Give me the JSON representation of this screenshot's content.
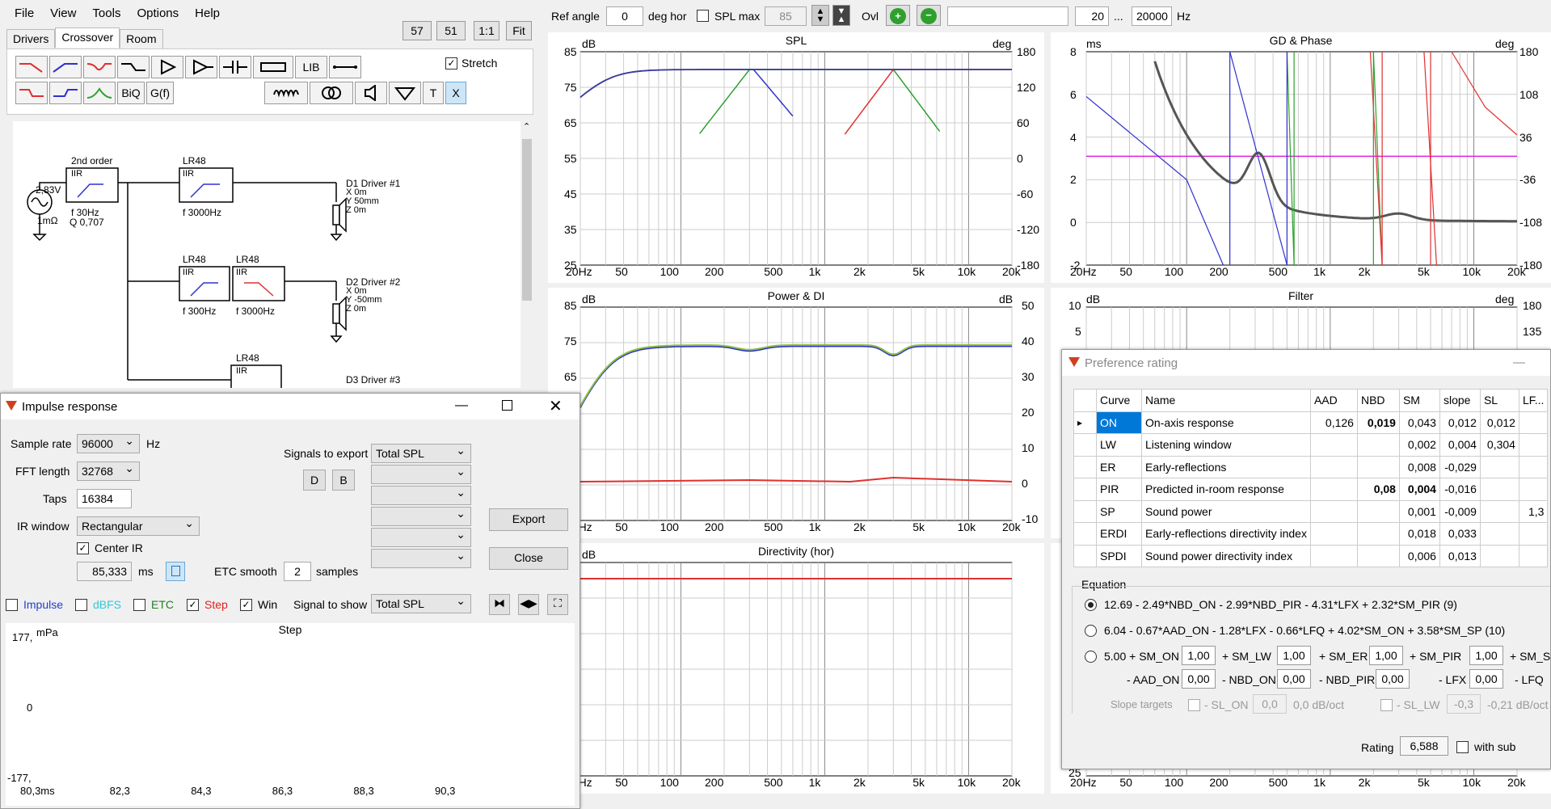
{
  "menu": [
    "File",
    "View",
    "Tools",
    "Options",
    "Help"
  ],
  "tabs": [
    "Drivers",
    "Crossover",
    "Room"
  ],
  "view_buttons": [
    "57",
    "51",
    "1:1",
    "Fit"
  ],
  "top_controls": {
    "ref_angle_label": "Ref angle",
    "ref_angle_value": "0",
    "deg_hor": "deg hor",
    "spl_max_label": "SPL max",
    "spl_max_value": "85",
    "ovl_label": "Ovl",
    "freq_min": "20",
    "dots": "...",
    "freq_max": "20000",
    "hz": "Hz"
  },
  "toolbar": {
    "lib": "LIB",
    "biq": "BiQ",
    "gf": "G(f)",
    "t": "T",
    "x": "X",
    "stretch_label": "Stretch"
  },
  "schematic": {
    "source_v": "2,83V",
    "source_r": "1mΩ",
    "block1_title": "2nd order",
    "block1_type": "IIR",
    "block1_f": "f  30Hz",
    "block1_q": "Q 0,707",
    "lr48": "LR48",
    "iir": "IIR",
    "f3000": "f  3000Hz",
    "f300": "f  300Hz",
    "d1_name": "D1 Driver #1",
    "d1_x": "X 0m",
    "d1_y": "Y 50mm",
    "d1_z": "Z 0m",
    "d2_name": "D2 Driver #2",
    "d2_x": "X 0m",
    "d2_y": "Y -50mm",
    "d2_z": "Z 0m",
    "d3_name": "D3 Driver #3"
  },
  "freq_ticks": [
    "20Hz",
    "50",
    "100",
    "200",
    "500",
    "1k",
    "2k",
    "5k",
    "10k",
    "20k"
  ],
  "spl_chart": {
    "title": "SPL",
    "left_unit": "dB",
    "right_unit": "deg",
    "left_ticks": [
      "85",
      "75",
      "65",
      "55",
      "45",
      "35",
      "25"
    ],
    "right_ticks": [
      "180",
      "120",
      "60",
      "0",
      "-60",
      "-120",
      "-180"
    ]
  },
  "gd_chart": {
    "title": "GD & Phase",
    "left_unit": "ms",
    "right_unit": "deg",
    "left_ticks": [
      "8",
      "6",
      "4",
      "2",
      "0",
      "-2"
    ],
    "right_ticks": [
      "180",
      "108",
      "36",
      "-36",
      "-108",
      "-180"
    ]
  },
  "power_chart": {
    "title": "Power & DI",
    "left_unit": "dB",
    "right_unit": "dB",
    "left_ticks": [
      "85",
      "75",
      "65"
    ],
    "right_ticks": [
      "50",
      "40",
      "30",
      "20",
      "10",
      "0",
      "-10"
    ]
  },
  "filter_chart": {
    "title": "Filter",
    "left_unit": "dB",
    "right_unit": "deg",
    "left_ticks": [
      "10",
      "5"
    ],
    "right_ticks": [
      "180",
      "135"
    ],
    "bottom_tick": "25"
  },
  "directivity_chart": {
    "title": "Directivity (hor)",
    "left_unit": "dB"
  },
  "impulse_window": {
    "title": "Impulse response",
    "sample_rate_label": "Sample rate",
    "sample_rate": "96000",
    "hz": "Hz",
    "fft_label": "FFT length",
    "fft": "32768",
    "taps_label": "Taps",
    "taps": "16384",
    "irwin_label": "IR window",
    "irwin": "Rectangular",
    "center_ir_label": "Center IR",
    "center_ms": "85,333",
    "ms": "ms",
    "etc_label": "ETC smooth",
    "etc_value": "2",
    "samples": "samples",
    "signals_export_label": "Signals to export",
    "signal_export_value": "Total SPL",
    "d_btn": "D",
    "b_btn": "B",
    "export_btn": "Export",
    "close_btn": "Close",
    "chk_impulse": "Impulse",
    "chk_dbfs": "dBFS",
    "chk_etc": "ETC",
    "chk_step": "Step",
    "chk_win": "Win",
    "signal_show_label": "Signal to show",
    "signal_show": "Total SPL",
    "plot_title": "Step",
    "y_unit": "mPa",
    "y_top": "177,",
    "y_zero": "0",
    "y_bottom": "-177,",
    "x_ticks": [
      "80,3ms",
      "82,3",
      "84,3",
      "86,3",
      "88,3",
      "90,3"
    ]
  },
  "pref_window": {
    "title": "Preference rating",
    "minimize": "—",
    "columns": [
      "Curve",
      "Name",
      "AAD",
      "NBD",
      "SM",
      "slope",
      "SL",
      "LF..."
    ],
    "rows": [
      {
        "curve": "ON",
        "name": "On-axis response",
        "aad": "0,126",
        "nbd": "0,019",
        "sm": "0,043",
        "slope": "0,012",
        "sl": "0,012",
        "lf": ""
      },
      {
        "curve": "LW",
        "name": "Listening window",
        "aad": "",
        "nbd": "",
        "sm": "0,002",
        "slope": "0,004",
        "sl": "0,304",
        "lf": ""
      },
      {
        "curve": "ER",
        "name": "Early-reflections",
        "aad": "",
        "nbd": "",
        "sm": "0,008",
        "slope": "-0,029",
        "sl": "",
        "lf": ""
      },
      {
        "curve": "PIR",
        "name": "Predicted in-room response",
        "aad": "",
        "nbd": "0,08",
        "sm": "0,004",
        "slope": "-0,016",
        "sl": "",
        "lf": ""
      },
      {
        "curve": "SP",
        "name": "Sound power",
        "aad": "",
        "nbd": "",
        "sm": "0,001",
        "slope": "-0,009",
        "sl": "",
        "lf": "1,3"
      },
      {
        "curve": "ERDI",
        "name": "Early-reflections directivity index",
        "aad": "",
        "nbd": "",
        "sm": "0,018",
        "slope": "0,033",
        "sl": "",
        "lf": ""
      },
      {
        "curve": "SPDI",
        "name": "Sound power directivity index",
        "aad": "",
        "nbd": "",
        "sm": "0,006",
        "slope": "0,013",
        "sl": "",
        "lf": ""
      }
    ],
    "equation_label": "Equation",
    "eq1": "12.69 - 2.49*NBD_ON - 2.99*NBD_PIR - 4.31*LFX + 2.32*SM_PIR (9)",
    "eq2": "6.04 - 0.67*AAD_ON - 1.28*LFX - 0.66*LFQ + 4.02*SM_ON + 3.58*SM_SP (10)",
    "eq3_start": "5.00 + SM_ON",
    "eq3_sm_lw": "+ SM_LW",
    "eq3_sm_er": "+ SM_ER",
    "eq3_sm_pir": "+ SM_PIR",
    "eq3_sm_sp": "+ SM_SP",
    "eq3_aad_on": "- AAD_ON",
    "eq3_nbd_on": "- NBD_ON",
    "eq3_nbd_pir": "- NBD_PIR",
    "eq3_lfx": "- LFX",
    "eq3_lfq": "- LFQ",
    "w_one": "1,00",
    "w_zero": "0,00",
    "slope_targets": "Slope targets",
    "sl_on": "- SL_ON",
    "sl_on_val": "0,0",
    "sl_on_unit": "0,0 dB/oct",
    "sl_lw": "- SL_LW",
    "sl_lw_val": "-0,3",
    "sl_lw_unit": "-0,21 dB/oct",
    "rating_label": "Rating",
    "rating": "6,588",
    "with_sub": "with sub"
  },
  "colors": {
    "blue": "#3030d0",
    "green": "#2ea02e",
    "red": "#e03030",
    "dark": "#555",
    "magenta": "#e020e0",
    "accent_sel": "#0078d7"
  }
}
